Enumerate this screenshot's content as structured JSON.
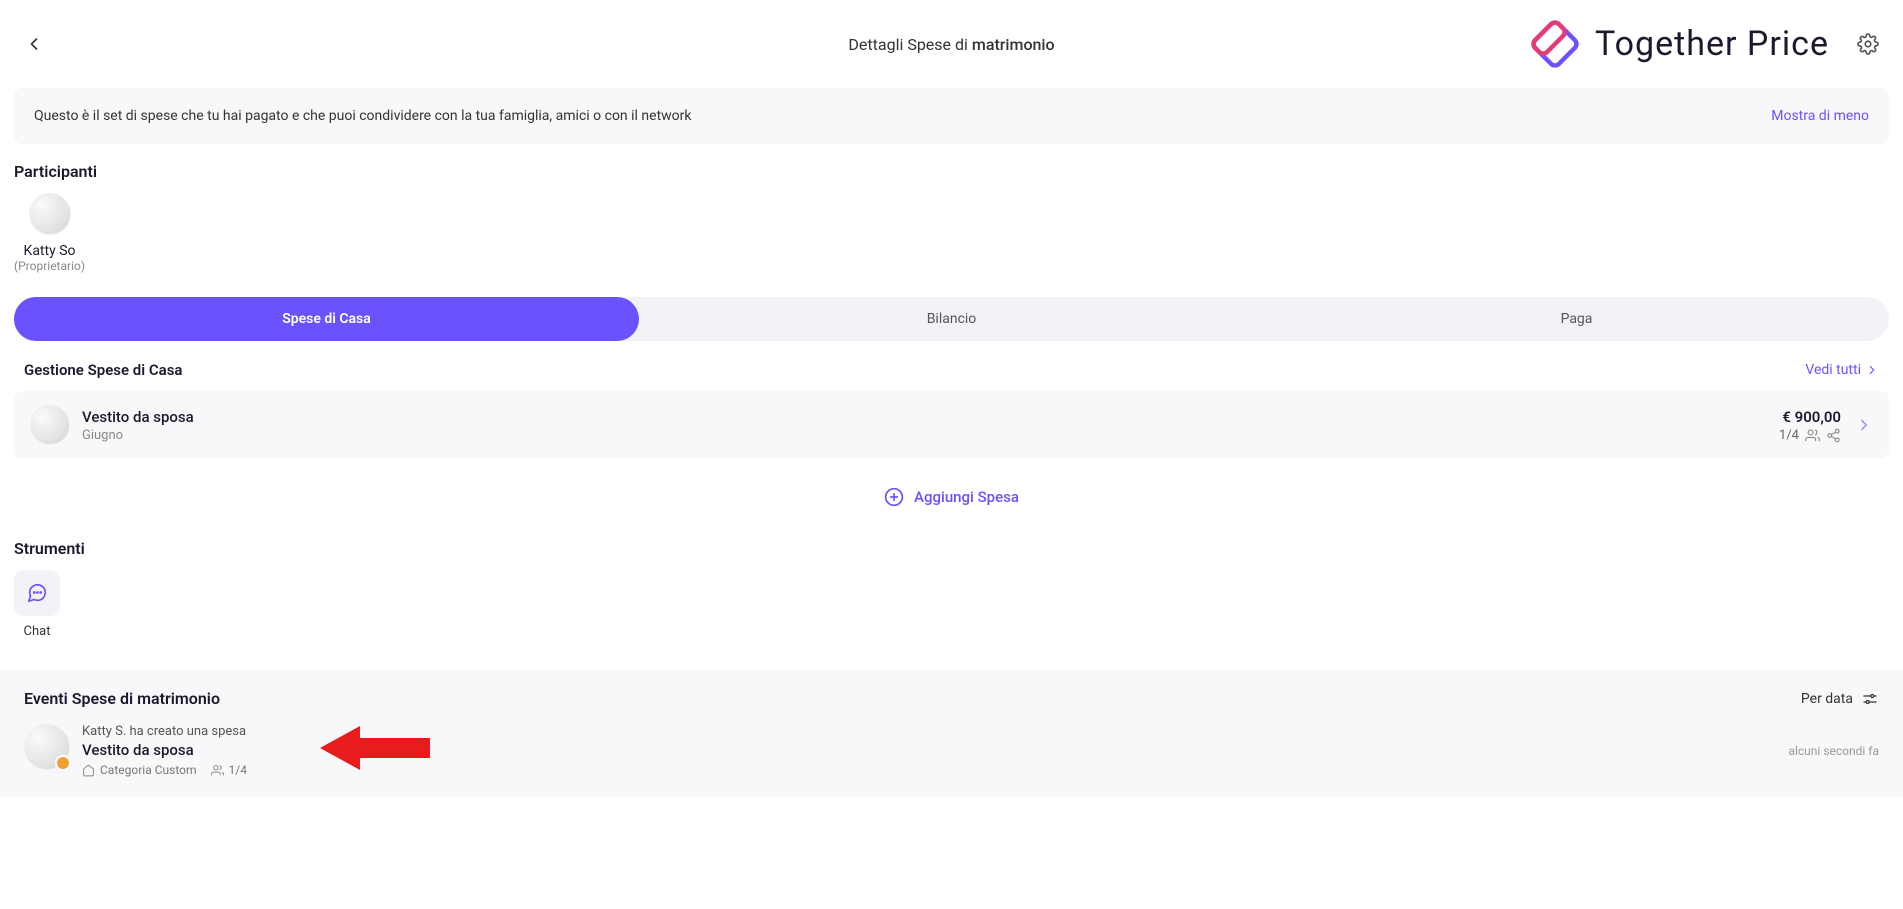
{
  "header": {
    "title_prefix": "Dettagli Spese di ",
    "title_em": "matrimonio",
    "logo_text": "Together Price"
  },
  "info": {
    "text": "Questo è il set di spese che tu hai pagato e che puoi condividere con la tua famiglia, amici o con il network",
    "show_less": "Mostra di meno"
  },
  "participants": {
    "title": "Participanti",
    "items": [
      {
        "name": "Katty So",
        "role": "(Proprietario)"
      }
    ]
  },
  "tabs": [
    {
      "label": "Spese di Casa",
      "active": true
    },
    {
      "label": "Bilancio",
      "active": false
    },
    {
      "label": "Paga",
      "active": false
    }
  ],
  "expenses": {
    "header": "Gestione Spese di Casa",
    "see_all": "Vedi tutti",
    "items": [
      {
        "name": "Vestito da sposa",
        "sub": "Giugno",
        "amount": "€ 900,00",
        "count": "1/4"
      }
    ],
    "add_label": "Aggiungi Spesa"
  },
  "tools": {
    "title": "Strumenti",
    "items": [
      {
        "label": "Chat"
      }
    ]
  },
  "events": {
    "title_prefix": "Eventi Spese di ",
    "title_em": "matrimonio",
    "sort_label": "Per data",
    "items": [
      {
        "line1": "Katty S. ha creato una spesa",
        "line2": "Vestito da sposa",
        "category": "Categoria Custom",
        "count": "1/4",
        "time": "alcuni secondi fa"
      }
    ]
  }
}
